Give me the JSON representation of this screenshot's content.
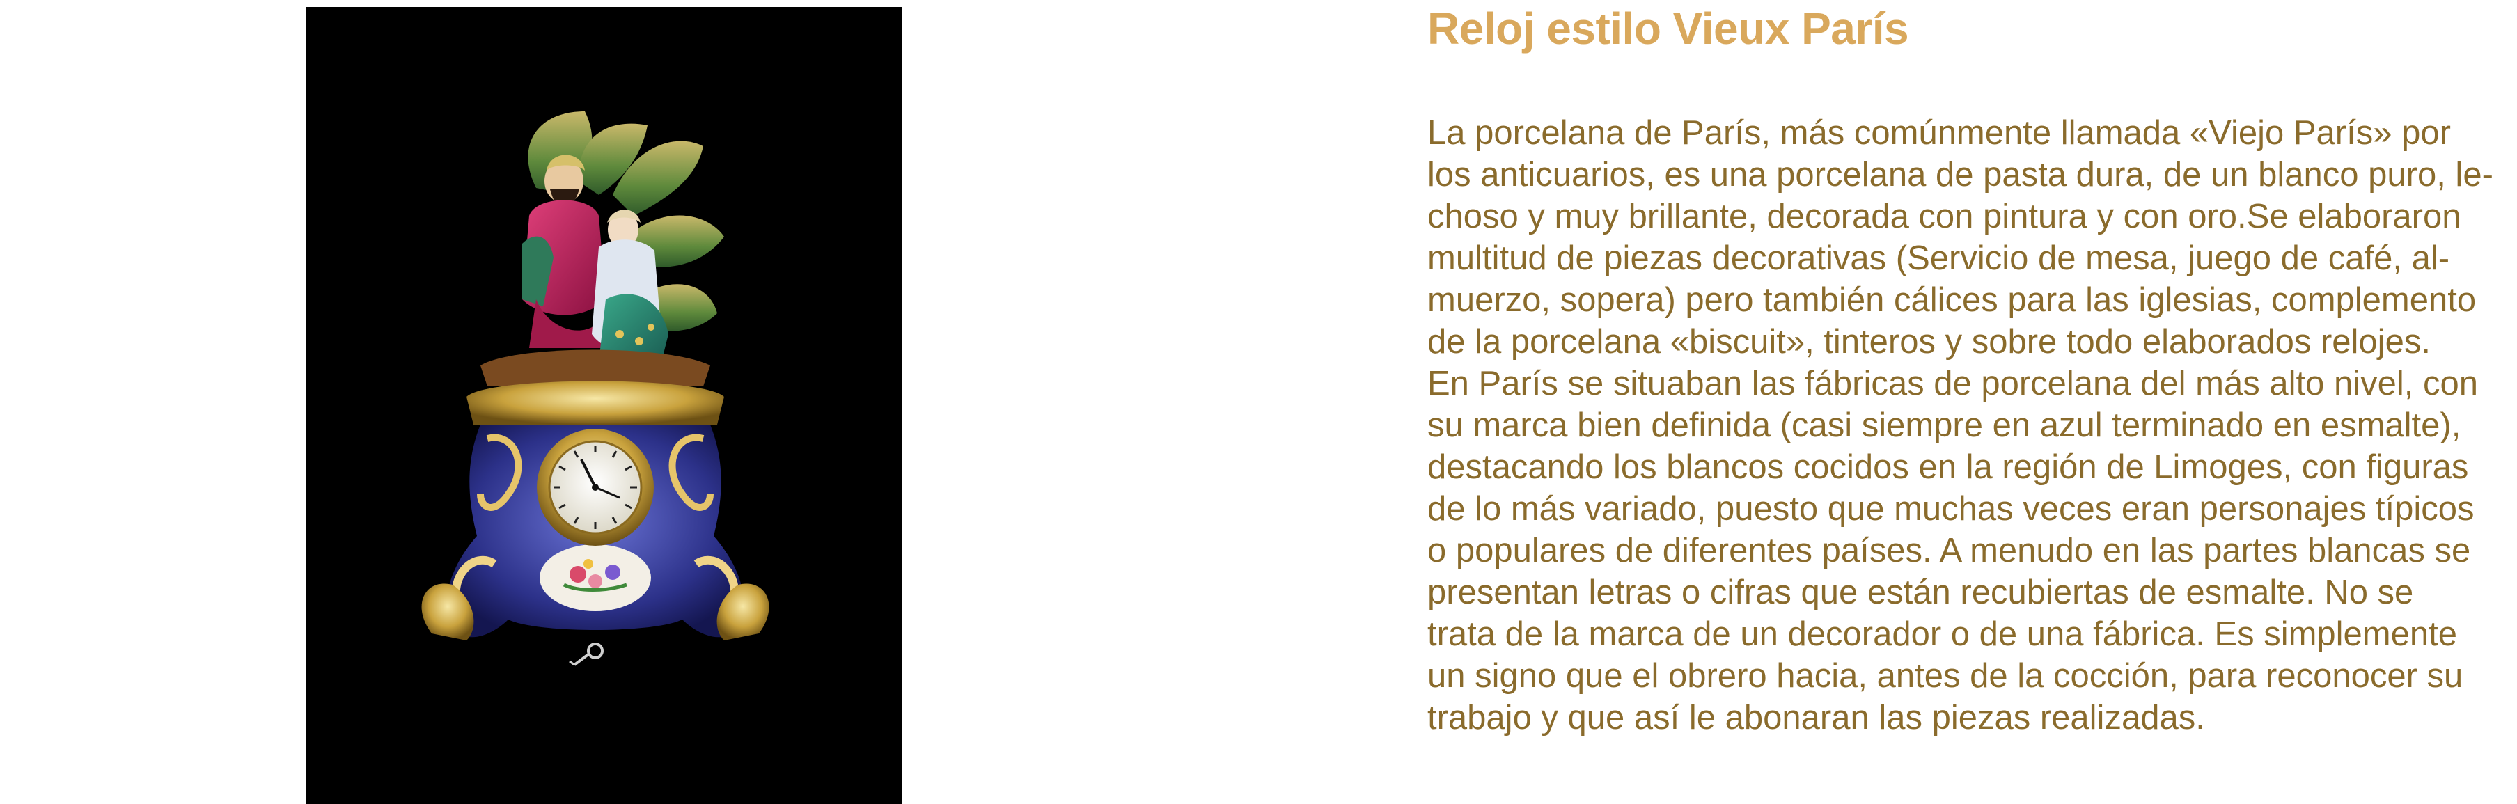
{
  "article": {
    "title": "Reloj estilo Vieux París",
    "body_lines": [
      "La porcelana de París, más comúnmente llamada «Viejo París» por",
      "los anticuarios, es una porcelana de pasta dura, de un blanco puro, le-",
      "choso y muy brillante, decorada con pintura y con oro.Se elaboraron",
      "multitud de piezas decorativas (Servicio de mesa, juego de café, al-",
      "muerzo, sopera) pero también cálices para las iglesias, complemento",
      "de la porcelana «biscuit», tinteros y sobre todo elaborados relojes.",
      "En París se situaban las fábricas de porcelana del más alto nivel, con",
      "su marca bien definida (casi siempre en azul terminado en esmalte),",
      "destacando los blancos cocidos en la región de Limoges, con figuras",
      "de lo más variado, puesto que muchas veces eran personajes típicos",
      "o populares de diferentes países. A menudo en las partes blancas se",
      "presentan letras o cifras que están recubiertas de esmalte. No se",
      "trata de la marca de un decorador o de una fábrica. Es simplemente",
      "un signo que el obrero hacia, antes de la cocción, para reconocer su",
      "trabajo y que así le abonaran las piezas realizadas."
    ]
  },
  "photo": {
    "subject": "porcelain-mantel-clock",
    "background_color": "#000000"
  },
  "colors": {
    "title": "#d9a85c",
    "body": "#8a6b2c",
    "page_background": "#ffffff"
  }
}
